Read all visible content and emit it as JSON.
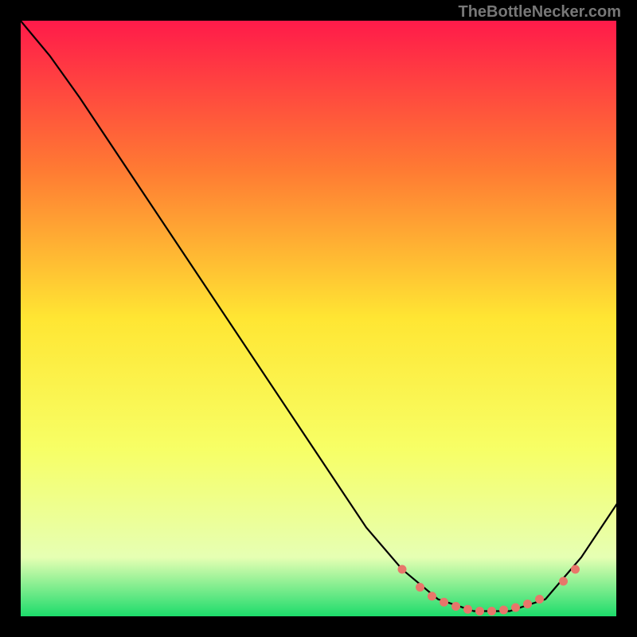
{
  "attribution": "TheBottleNecker.com",
  "chart_data": {
    "type": "line",
    "title": "",
    "xlabel": "",
    "ylabel": "",
    "xlim": [
      0,
      100
    ],
    "ylim": [
      0,
      100
    ],
    "background": {
      "type": "vertical-gradient",
      "stops": [
        {
          "offset": 0,
          "color": "#ff1a4a"
        },
        {
          "offset": 25,
          "color": "#ff7a33"
        },
        {
          "offset": 50,
          "color": "#ffe633"
        },
        {
          "offset": 72,
          "color": "#f7ff66"
        },
        {
          "offset": 90,
          "color": "#e6ffb3"
        },
        {
          "offset": 100,
          "color": "#1adb6a"
        }
      ]
    },
    "series": [
      {
        "name": "curve",
        "stroke": "#000000",
        "points": [
          {
            "x": 0,
            "y": 100
          },
          {
            "x": 5,
            "y": 94
          },
          {
            "x": 10,
            "y": 87
          },
          {
            "x": 20,
            "y": 72
          },
          {
            "x": 30,
            "y": 57
          },
          {
            "x": 40,
            "y": 42
          },
          {
            "x": 50,
            "y": 27
          },
          {
            "x": 58,
            "y": 15
          },
          {
            "x": 64,
            "y": 8
          },
          {
            "x": 70,
            "y": 3
          },
          {
            "x": 76,
            "y": 1
          },
          {
            "x": 82,
            "y": 1
          },
          {
            "x": 88,
            "y": 3
          },
          {
            "x": 94,
            "y": 10
          },
          {
            "x": 100,
            "y": 19
          }
        ]
      }
    ],
    "markers": [
      {
        "x": 64,
        "y": 8
      },
      {
        "x": 67,
        "y": 5
      },
      {
        "x": 69,
        "y": 3.5
      },
      {
        "x": 71,
        "y": 2.5
      },
      {
        "x": 73,
        "y": 1.8
      },
      {
        "x": 75,
        "y": 1.3
      },
      {
        "x": 77,
        "y": 1
      },
      {
        "x": 79,
        "y": 1
      },
      {
        "x": 81,
        "y": 1.2
      },
      {
        "x": 83,
        "y": 1.6
      },
      {
        "x": 85,
        "y": 2.2
      },
      {
        "x": 87,
        "y": 3
      },
      {
        "x": 91,
        "y": 6
      },
      {
        "x": 93,
        "y": 8
      }
    ],
    "marker_color": "#e8766a"
  }
}
